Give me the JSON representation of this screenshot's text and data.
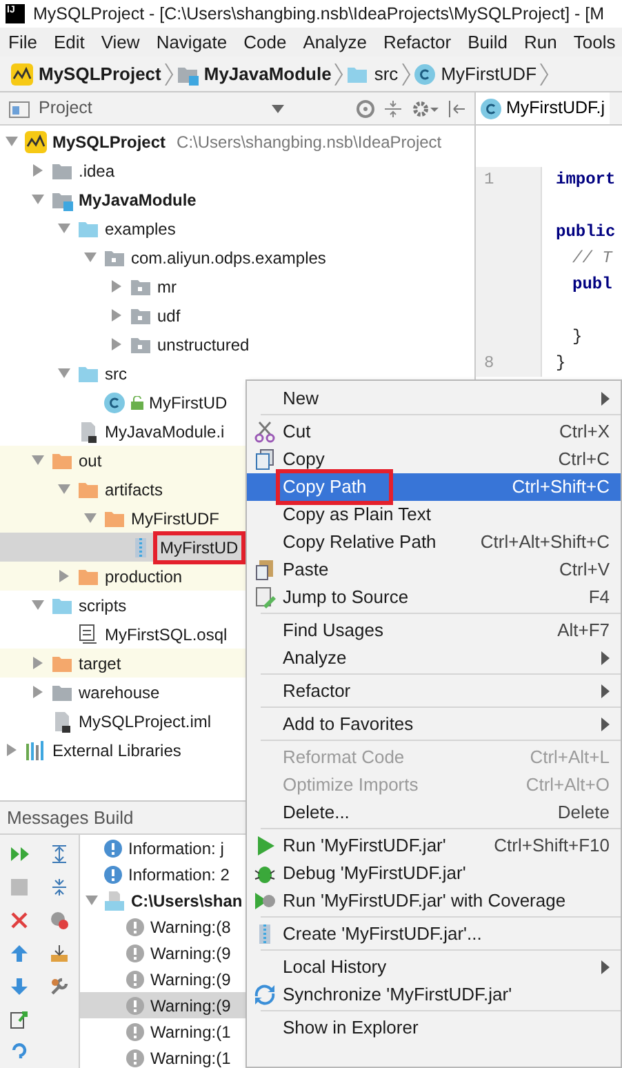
{
  "window": {
    "logo": "IJ",
    "title": "MySQLProject - [C:\\Users\\shangbing.nsb\\IdeaProjects\\MySQLProject] - [M"
  },
  "menu_bar": [
    "File",
    "Edit",
    "View",
    "Navigate",
    "Code",
    "Analyze",
    "Refactor",
    "Build",
    "Run",
    "Tools"
  ],
  "breadcrumb": [
    {
      "label": "MySQLProject",
      "kind": "project"
    },
    {
      "label": "MyJavaModule",
      "kind": "module"
    },
    {
      "label": "src",
      "kind": "source"
    },
    {
      "label": "MyFirstUDF",
      "kind": "class"
    }
  ],
  "project_panel": {
    "title": "Project",
    "tree": [
      {
        "kind": "project",
        "label": "MySQLProject",
        "path": "C:\\Users\\shangbing.nsb\\IdeaProject",
        "expanded": true,
        "excluded": false,
        "selected": false,
        "children": [
          {
            "kind": "folder",
            "label": ".idea",
            "expanded": false,
            "excluded": false,
            "selected": false
          },
          {
            "kind": "module",
            "label": "MyJavaModule",
            "expanded": true,
            "excluded": false,
            "selected": false,
            "children": [
              {
                "kind": "source",
                "label": "examples",
                "expanded": true,
                "excluded": false,
                "selected": false,
                "children": [
                  {
                    "kind": "package",
                    "label": "com.aliyun.odps.examples",
                    "expanded": true,
                    "excluded": false,
                    "selected": false,
                    "children": [
                      {
                        "kind": "package",
                        "label": "mr",
                        "expanded": false,
                        "excluded": false,
                        "selected": false
                      },
                      {
                        "kind": "package",
                        "label": "udf",
                        "expanded": false,
                        "excluded": false,
                        "selected": false
                      },
                      {
                        "kind": "package",
                        "label": "unstructured",
                        "expanded": false,
                        "excluded": false,
                        "selected": false
                      }
                    ]
                  }
                ]
              },
              {
                "kind": "source",
                "label": "src",
                "expanded": true,
                "excluded": false,
                "selected": false,
                "children": [
                  {
                    "kind": "class",
                    "label": "MyFirstUD",
                    "excluded": false,
                    "selected": false
                  }
                ]
              },
              {
                "kind": "iml",
                "label": "MyJavaModule.i",
                "excluded": false,
                "selected": false
              }
            ]
          },
          {
            "kind": "excluded",
            "label": "out",
            "expanded": true,
            "excluded": true,
            "selected": false,
            "children": [
              {
                "kind": "excluded",
                "label": "artifacts",
                "expanded": true,
                "excluded": true,
                "selected": false,
                "children": [
                  {
                    "kind": "excluded",
                    "label": "MyFirstUDF",
                    "expanded": true,
                    "excluded": true,
                    "selected": false,
                    "children": [
                      {
                        "kind": "jar",
                        "label": "MyFirstUD",
                        "excluded": true,
                        "selected": true,
                        "annotated": true
                      }
                    ]
                  }
                ]
              },
              {
                "kind": "excluded",
                "label": "production",
                "expanded": false,
                "excluded": true,
                "selected": false
              }
            ]
          },
          {
            "kind": "source",
            "label": "scripts",
            "expanded": true,
            "excluded": false,
            "selected": false,
            "children": [
              {
                "kind": "osql",
                "label": "MyFirstSQL.osql",
                "excluded": false,
                "selected": false
              }
            ]
          },
          {
            "kind": "excluded",
            "label": "target",
            "expanded": false,
            "excluded": true,
            "selected": false
          },
          {
            "kind": "folder",
            "label": "warehouse",
            "expanded": false,
            "excluded": false,
            "selected": false
          },
          {
            "kind": "iml",
            "label": "MySQLProject.iml",
            "excluded": false,
            "selected": false
          }
        ]
      },
      {
        "kind": "libraries",
        "label": "External Libraries",
        "expanded": false,
        "excluded": false,
        "selected": false
      }
    ]
  },
  "editor": {
    "tabs": [
      {
        "label": "MyFirstUDF.j",
        "selected": true
      }
    ],
    "lines": [
      {
        "number": "1",
        "code": "import",
        "kind": "keyword",
        "indent": false
      },
      {
        "kind": "blank"
      },
      {
        "code": "public",
        "kind": "keyword",
        "indent": false
      },
      {
        "code": "// T",
        "kind": "comment",
        "indent": true
      },
      {
        "code": "publ",
        "kind": "keyword",
        "indent": true
      },
      {
        "kind": "blank"
      },
      {
        "code": "}",
        "kind": "plain",
        "indent": true
      },
      {
        "number": "8",
        "code": "}",
        "kind": "plain",
        "indent": false
      }
    ]
  },
  "context_menu": [
    {
      "kind": "plain",
      "label": "New",
      "submenu": true,
      "disabled": false,
      "selected": false
    },
    {
      "kind": "separator"
    },
    {
      "kind": "cut",
      "label": "Cut",
      "shortcut": "Ctrl+X",
      "submenu": false,
      "disabled": false,
      "selected": false
    },
    {
      "kind": "copy",
      "label": "Copy",
      "shortcut": "Ctrl+C",
      "submenu": false,
      "disabled": false,
      "selected": false
    },
    {
      "kind": "plain",
      "label": "Copy Path",
      "shortcut": "Ctrl+Shift+C",
      "submenu": false,
      "disabled": false,
      "selected": true,
      "annotated": true
    },
    {
      "kind": "plain",
      "label": "Copy as Plain Text",
      "submenu": false,
      "disabled": false,
      "selected": false
    },
    {
      "kind": "plain",
      "label": "Copy Relative Path",
      "shortcut": "Ctrl+Alt+Shift+C",
      "submenu": false,
      "disabled": false,
      "selected": false
    },
    {
      "kind": "paste",
      "label": "Paste",
      "shortcut": "Ctrl+V",
      "submenu": false,
      "disabled": false,
      "selected": false
    },
    {
      "kind": "edit",
      "label": "Jump to Source",
      "shortcut": "F4",
      "submenu": false,
      "disabled": false,
      "selected": false
    },
    {
      "kind": "separator"
    },
    {
      "kind": "plain",
      "label": "Find Usages",
      "shortcut": "Alt+F7",
      "submenu": false,
      "disabled": false,
      "selected": false
    },
    {
      "kind": "plain",
      "label": "Analyze",
      "submenu": true,
      "disabled": false,
      "selected": false
    },
    {
      "kind": "separator"
    },
    {
      "kind": "plain",
      "label": "Refactor",
      "submenu": true,
      "disabled": false,
      "selected": false
    },
    {
      "kind": "separator"
    },
    {
      "kind": "plain",
      "label": "Add to Favorites",
      "submenu": true,
      "disabled": false,
      "selected": false
    },
    {
      "kind": "separator"
    },
    {
      "kind": "plain",
      "label": "Reformat Code",
      "shortcut": "Ctrl+Alt+L",
      "submenu": false,
      "disabled": true,
      "selected": false
    },
    {
      "kind": "plain",
      "label": "Optimize Imports",
      "shortcut": "Ctrl+Alt+O",
      "submenu": false,
      "disabled": true,
      "selected": false
    },
    {
      "kind": "plain",
      "label": "Delete...",
      "shortcut": "Delete",
      "submenu": false,
      "disabled": false,
      "selected": false
    },
    {
      "kind": "separator"
    },
    {
      "kind": "run",
      "label": "Run 'MyFirstUDF.jar'",
      "shortcut": "Ctrl+Shift+F10",
      "submenu": false,
      "disabled": false,
      "selected": false
    },
    {
      "kind": "debug",
      "label": "Debug 'MyFirstUDF.jar'",
      "submenu": false,
      "disabled": false,
      "selected": false
    },
    {
      "kind": "coverage",
      "label": "Run 'MyFirstUDF.jar' with Coverage",
      "submenu": false,
      "disabled": false,
      "selected": false
    },
    {
      "kind": "separator"
    },
    {
      "kind": "jar",
      "label": "Create 'MyFirstUDF.jar'...",
      "submenu": false,
      "disabled": false,
      "selected": false
    },
    {
      "kind": "separator"
    },
    {
      "kind": "plain",
      "label": "Local History",
      "submenu": true,
      "disabled": false,
      "selected": false
    },
    {
      "kind": "sync",
      "label": "Synchronize 'MyFirstUDF.jar'",
      "submenu": false,
      "disabled": false,
      "selected": false
    },
    {
      "kind": "separator"
    },
    {
      "kind": "plain",
      "label": "Show in Explorer",
      "submenu": false,
      "disabled": false,
      "selected": false
    }
  ],
  "messages": {
    "title": "Messages Build",
    "rows": [
      {
        "kind": "info",
        "text": "Information: j",
        "selected": false
      },
      {
        "kind": "info",
        "text": "Information: 2",
        "selected": false
      },
      {
        "kind": "file",
        "text": "C:\\Users\\shan",
        "expanded": true,
        "selected": false,
        "children": [
          {
            "kind": "warning",
            "text": "Warning:(8",
            "selected": false
          },
          {
            "kind": "warning",
            "text": "Warning:(9",
            "selected": false
          },
          {
            "kind": "warning",
            "text": "Warning:(9",
            "selected": false
          },
          {
            "kind": "warning",
            "text": "Warning:(9",
            "selected": true
          },
          {
            "kind": "warning",
            "text": "Warning:(1",
            "selected": false
          },
          {
            "kind": "warning",
            "text": "Warning:(1",
            "selected": false
          }
        ]
      }
    ]
  }
}
